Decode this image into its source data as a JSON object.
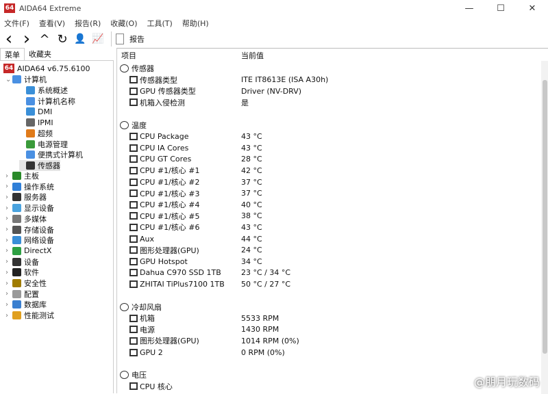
{
  "window": {
    "title": "AIDA64 Extreme",
    "logo": "64",
    "minimize": "—",
    "maximize": "☐",
    "close": "✕"
  },
  "menu": [
    "文件(F)",
    "查看(V)",
    "报告(R)",
    "收藏(O)",
    "工具(T)",
    "帮助(H)"
  ],
  "toolbar": {
    "back": "‹",
    "forward": "›",
    "up": "^",
    "refresh": "↻",
    "user": "👤",
    "chart": "📈",
    "report_label": "报告"
  },
  "left_tabs": [
    "菜单",
    "收藏夹"
  ],
  "tree": {
    "root": "AIDA64 v6.75.6100",
    "computer": "计算机",
    "computer_children": [
      "系统概述",
      "计算机名称",
      "DMI",
      "IPMI",
      "超频",
      "电源管理",
      "便携式计算机",
      "传感器"
    ],
    "top_items": [
      "主板",
      "操作系统",
      "服务器",
      "显示设备",
      "多媒体",
      "存储设备",
      "网络设备",
      "DirectX",
      "设备",
      "软件",
      "安全性",
      "配置",
      "数据库",
      "性能测试"
    ]
  },
  "columns": {
    "item": "项目",
    "value": "当前值"
  },
  "sections": [
    {
      "title": "传感器",
      "rows": [
        [
          "传感器类型",
          "ITE IT8613E  (ISA A30h)"
        ],
        [
          "GPU 传感器类型",
          "Driver  (NV-DRV)"
        ],
        [
          "机箱入侵检测",
          "是"
        ]
      ]
    },
    {
      "title": "温度",
      "rows": [
        [
          "CPU Package",
          "43 °C"
        ],
        [
          "CPU IA Cores",
          "43 °C"
        ],
        [
          "CPU GT Cores",
          "28 °C"
        ],
        [
          "CPU #1/核心 #1",
          "42 °C"
        ],
        [
          "CPU #1/核心 #2",
          "37 °C"
        ],
        [
          "CPU #1/核心 #3",
          "37 °C"
        ],
        [
          "CPU #1/核心 #4",
          "40 °C"
        ],
        [
          "CPU #1/核心 #5",
          "38 °C"
        ],
        [
          "CPU #1/核心 #6",
          "43 °C"
        ],
        [
          "Aux",
          "44 °C"
        ],
        [
          "图形处理器(GPU)",
          "24 °C"
        ],
        [
          "GPU Hotspot",
          "34 °C"
        ],
        [
          "Dahua C970 SSD 1TB",
          "23 °C / 34 °C"
        ],
        [
          "ZHITAI TiPlus7100 1TB",
          "50 °C / 27 °C"
        ]
      ]
    },
    {
      "title": "冷却风扇",
      "rows": [
        [
          "机箱",
          "5533 RPM"
        ],
        [
          "电源",
          "1430 RPM"
        ],
        [
          "图形处理器(GPU)",
          "1014 RPM  (0%)"
        ],
        [
          "GPU 2",
          "0 RPM  (0%)"
        ]
      ]
    },
    {
      "title": "电压",
      "rows": [
        [
          "CPU 核心",
          ""
        ]
      ]
    }
  ],
  "watermark": "@朋月玩数码"
}
